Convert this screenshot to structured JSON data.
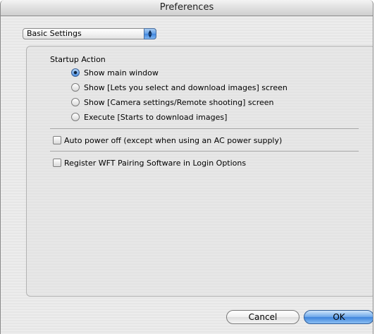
{
  "window": {
    "title": "Preferences"
  },
  "settings_popup": {
    "selected": "Basic Settings"
  },
  "startup": {
    "label": "Startup Action",
    "options": [
      {
        "label": "Show main window",
        "selected": true
      },
      {
        "label": "Show [Lets you select and download images] screen",
        "selected": false
      },
      {
        "label": "Show [Camera settings/Remote shooting] screen",
        "selected": false
      },
      {
        "label": "Execute [Starts to download images]",
        "selected": false
      }
    ]
  },
  "checkboxes": {
    "auto_power_off": {
      "label": "Auto power off (except when using an AC power supply)",
      "checked": false
    },
    "register_wft": {
      "label": "Register WFT Pairing Software in Login Options",
      "checked": false
    }
  },
  "buttons": {
    "cancel": "Cancel",
    "ok": "OK"
  }
}
